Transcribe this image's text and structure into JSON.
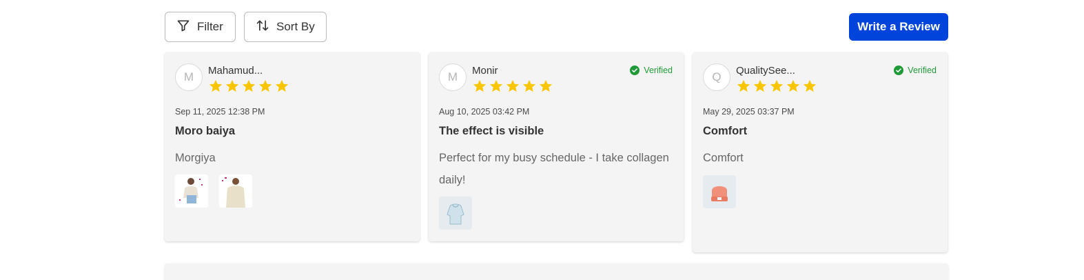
{
  "toolbar": {
    "filter_label": "Filter",
    "sort_label": "Sort By",
    "write_review_label": "Write a Review"
  },
  "colors": {
    "accent": "#0044db",
    "star": "#f7c600",
    "verified": "#1f9a36",
    "card_bg": "#f4f4f4"
  },
  "reviews": [
    {
      "avatar_letter": "M",
      "name": "Mahamud...",
      "rating": 5,
      "verified": false,
      "date": "Sep 11, 2025 12:38 PM",
      "title": "Moro baiya",
      "body": "Morgiya",
      "images": [
        "woman-photo",
        "woman-photo"
      ]
    },
    {
      "avatar_letter": "M",
      "name": "Monir",
      "rating": 5,
      "verified": true,
      "verified_label": "Verified",
      "date": "Aug 10, 2025 03:42 PM",
      "title": "The effect is visible",
      "body": "Perfect for my busy schedule - I take collagen daily!",
      "images": [
        "hoodie-photo"
      ]
    },
    {
      "avatar_letter": "Q",
      "name": "QualitySee...",
      "rating": 5,
      "verified": true,
      "verified_label": "Verified",
      "date": "May 29, 2025 03:37 PM",
      "title": "Comfort",
      "body": "Comfort",
      "images": [
        "beanie-photo"
      ]
    }
  ]
}
